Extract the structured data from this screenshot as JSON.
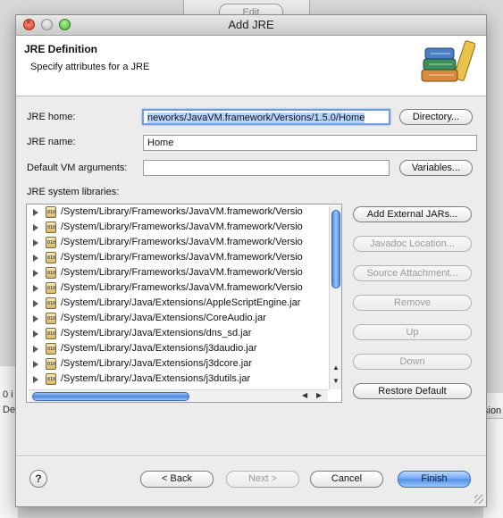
{
  "background": {
    "edit_button": "Edit",
    "left_fragments": [
      "0 i",
      "De"
    ],
    "right_fragment": "sion"
  },
  "window": {
    "title": "Add JRE"
  },
  "header": {
    "title": "JRE Definition",
    "subtitle": "Specify attributes for a JRE",
    "icon": "books-icon"
  },
  "form": {
    "jre_home_label": "JRE home:",
    "jre_home_value": "neworks/JavaVM.framework/Versions/1.5.0/Home",
    "directory_button": "Directory...",
    "jre_name_label": "JRE name:",
    "jre_name_value": "Home",
    "vm_args_label": "Default VM arguments:",
    "vm_args_value": "",
    "variables_button": "Variables...",
    "libraries_label": "JRE system libraries:"
  },
  "libraries": [
    "/System/Library/Frameworks/JavaVM.framework/Versio",
    "/System/Library/Frameworks/JavaVM.framework/Versio",
    "/System/Library/Frameworks/JavaVM.framework/Versio",
    "/System/Library/Frameworks/JavaVM.framework/Versio",
    "/System/Library/Frameworks/JavaVM.framework/Versio",
    "/System/Library/Frameworks/JavaVM.framework/Versio",
    "/System/Library/Java/Extensions/AppleScriptEngine.jar",
    "/System/Library/Java/Extensions/CoreAudio.jar",
    "/System/Library/Java/Extensions/dns_sd.jar",
    "/System/Library/Java/Extensions/j3daudio.jar",
    "/System/Library/Java/Extensions/j3dcore.jar",
    "/System/Library/Java/Extensions/j3dutils.jar"
  ],
  "jar_tag": "010",
  "library_buttons": {
    "add_external": "Add External JARs...",
    "javadoc": "Javadoc Location...",
    "source": "Source Attachment...",
    "remove": "Remove",
    "up": "Up",
    "down": "Down",
    "restore": "Restore Default"
  },
  "footer": {
    "help": "?",
    "back": "< Back",
    "next": "Next >",
    "cancel": "Cancel",
    "finish": "Finish"
  },
  "colors": {
    "default_button": "#6da6f0",
    "focus_ring": "#6f9ddb",
    "scroll_thumb": "#4f86dc"
  }
}
